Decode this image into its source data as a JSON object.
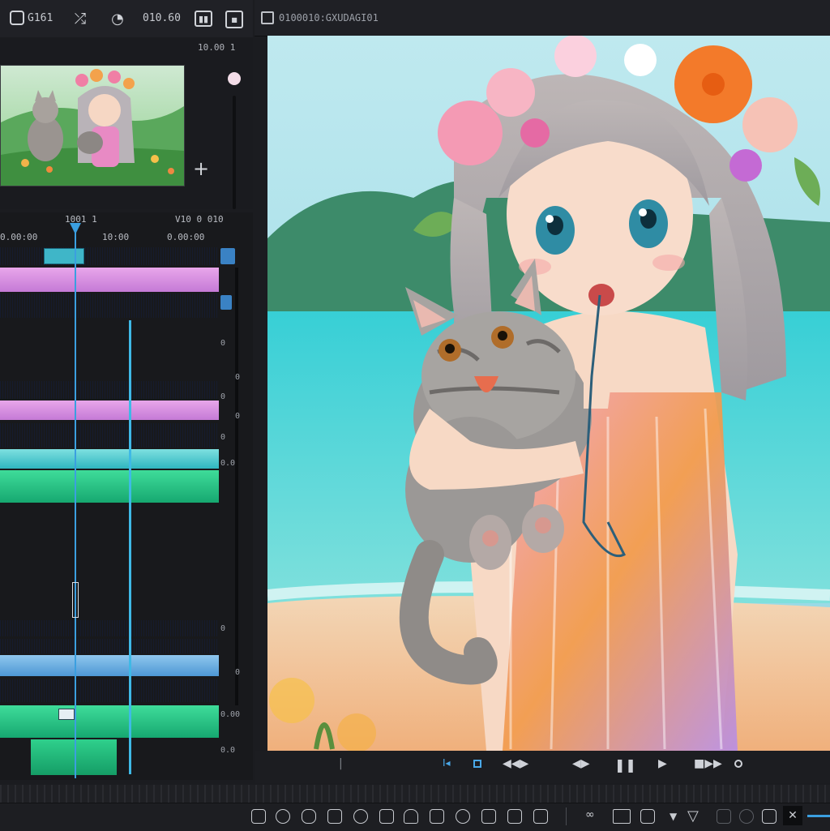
{
  "topbar": {
    "left_label": "G161",
    "time_label": "010.60"
  },
  "viewer": {
    "timecode": "0100010:GXUDAGI01"
  },
  "clip_panel": {
    "counter": "10.00 1"
  },
  "timeline": {
    "ruler_left": "1001 1",
    "ruler_right": "V10 0 010",
    "tick_labels": [
      "0.00:00",
      "10:00",
      "0.00:00"
    ],
    "side_labels": [
      "0",
      "0",
      "0",
      "0",
      "0",
      "0",
      "0.0",
      "0",
      "0.00",
      "0.0"
    ]
  },
  "colors": {
    "accent": "#3b9fe0",
    "pink_track": "#d48fe0",
    "cyan_track": "#4cc9d0",
    "blue_track": "#6aaee2",
    "green_track": "#22c47f"
  },
  "icons": {
    "top": [
      "app-icon",
      "shuffle-icon",
      "shape-icon",
      "layout-icon",
      "square-button-icon"
    ],
    "transport": [
      "skip-back-icon",
      "square-icon",
      "step-back-icon",
      "play-back-icon",
      "diamond-icon",
      "pause-icon",
      "play-icon",
      "fast-forward-icon",
      "circle-icon"
    ],
    "bottom": [
      "link-icon",
      "ring-icon",
      "shape-icon",
      "loop-icon",
      "rotate-icon",
      "grid-icon",
      "headphones-icon",
      "lock-icon",
      "loop-icon",
      "minus-icon",
      "link-icon",
      "rect-icon",
      "square-icon",
      "dropdown-icon",
      "triangle-icon",
      "square-icon",
      "circle-icon",
      "square-icon",
      "close-icon"
    ]
  }
}
